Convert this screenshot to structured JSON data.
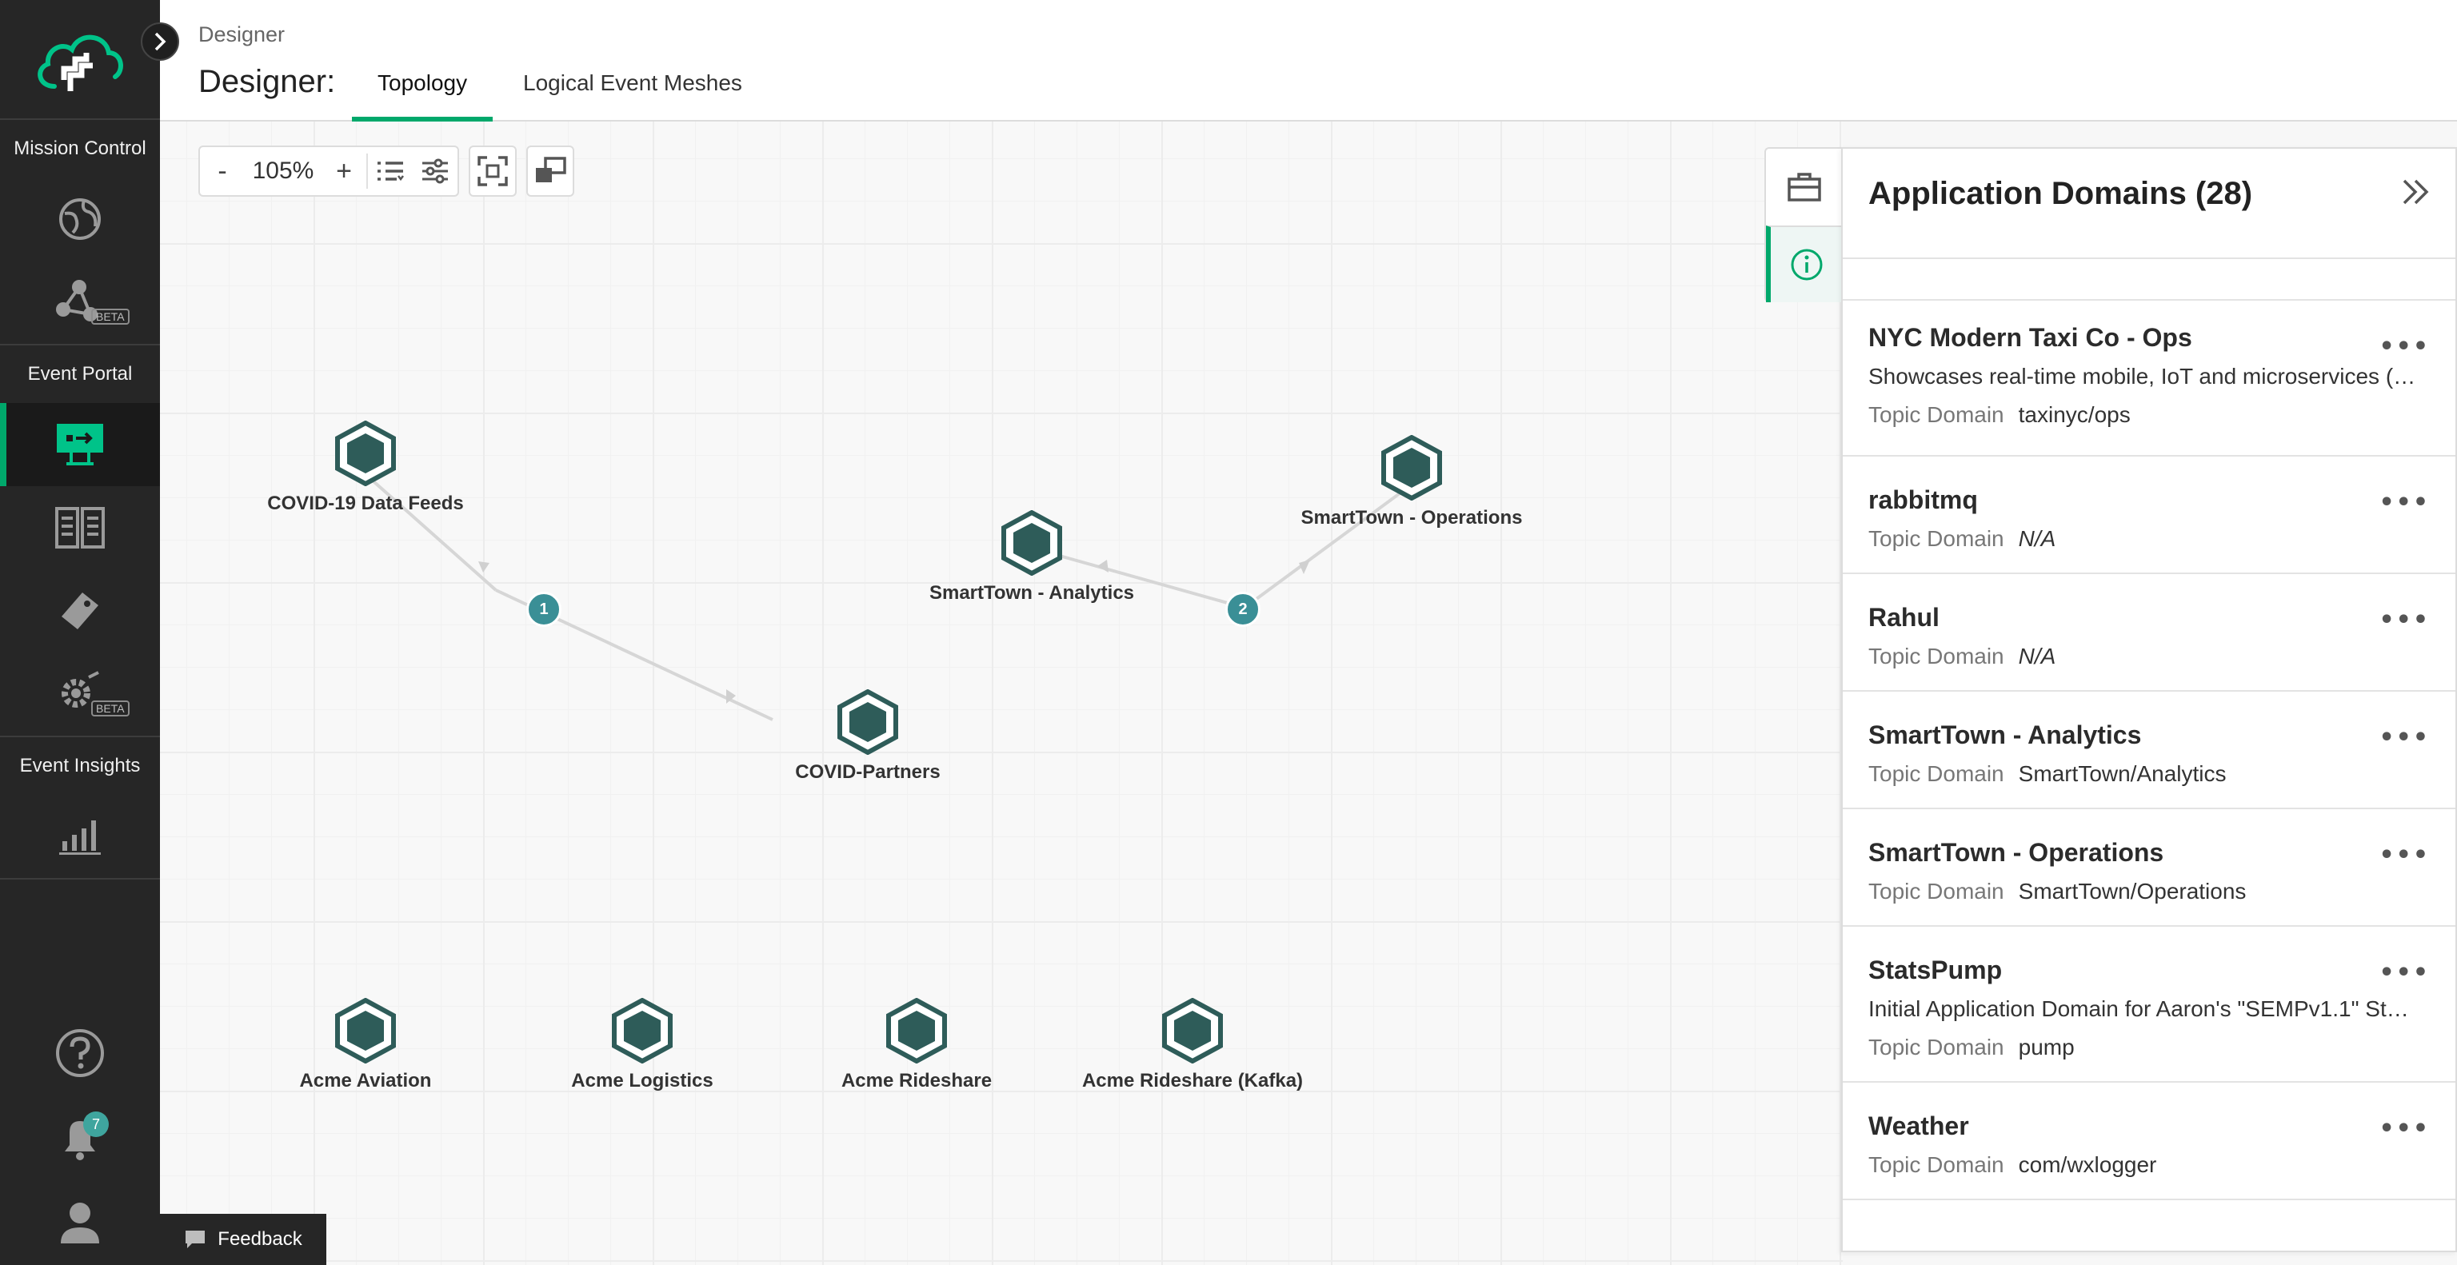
{
  "nav": {
    "sections": {
      "mission_control": "Mission Control",
      "event_portal": "Event Portal",
      "event_insights": "Event Insights"
    },
    "beta_label": "BETA",
    "notification_count": "7",
    "accent_color": "#00a86b"
  },
  "header": {
    "breadcrumb": "Designer",
    "title": "Designer:",
    "tabs": [
      "Topology",
      "Logical Event Meshes"
    ],
    "active_tab": "Topology"
  },
  "toolbar": {
    "zoom_out": "-",
    "zoom_level": "105%",
    "zoom_in": "+"
  },
  "graph": {
    "nodes": [
      "COVID-19 Data Feeds",
      "COVID-Partners",
      "SmartTown - Analytics",
      "SmartTown - Operations",
      "Acme Aviation",
      "Acme Logistics",
      "Acme Rideshare",
      "Acme Rideshare (Kafka)"
    ],
    "badges": [
      "1",
      "2"
    ],
    "node_color": "#2e5c59"
  },
  "feedback_label": "Feedback",
  "panel": {
    "title": "Application Domains (28)",
    "topic_label": "Topic Domain",
    "domains": [
      {
        "name": "NYC Modern Taxi Co - Ops",
        "description": "Showcases real-time mobile, IoT and microservices (…",
        "topic": "taxinyc/ops"
      },
      {
        "name": "rabbitmq",
        "description": "",
        "topic": "N/A"
      },
      {
        "name": "Rahul",
        "description": "",
        "topic": "N/A"
      },
      {
        "name": "SmartTown - Analytics",
        "description": "",
        "topic": "SmartTown/Analytics"
      },
      {
        "name": "SmartTown - Operations",
        "description": "",
        "topic": "SmartTown/Operations"
      },
      {
        "name": "StatsPump",
        "description": "Initial Application Domain for Aaron's \"SEMPv1.1\" Sta…",
        "topic": "pump"
      },
      {
        "name": "Weather",
        "description": "",
        "topic": "com/wxlogger"
      }
    ]
  }
}
